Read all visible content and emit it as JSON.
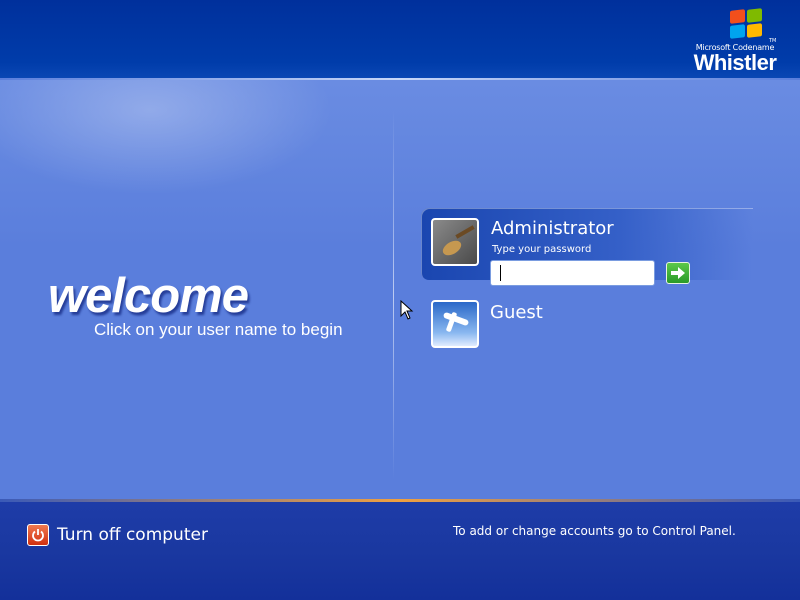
{
  "brand": {
    "subtitle": "Microsoft Codename",
    "name": "Whistler",
    "trademark": "TM",
    "logo_icon": "windows-flag-icon"
  },
  "welcome": {
    "title": "welcome",
    "subtitle": "Click on your user name to begin"
  },
  "users": [
    {
      "name": "Administrator",
      "avatar_icon": "guitar-avatar-icon",
      "selected": true,
      "password_label": "Type your password",
      "password_value": "",
      "go_icon": "arrow-right-icon"
    },
    {
      "name": "Guest",
      "avatar_icon": "airplane-avatar-icon",
      "selected": false
    }
  ],
  "footer": {
    "power_label": "Turn off computer",
    "power_icon": "power-icon",
    "hint": "To add or change accounts go to Control Panel."
  },
  "colors": {
    "top_bar": "#003399",
    "main_bg": "#5a7edc",
    "bottom_bar": "#1a38a0",
    "accent_orange": "#f0a040",
    "go_button": "#2a9a28",
    "power_button": "#d03010"
  }
}
